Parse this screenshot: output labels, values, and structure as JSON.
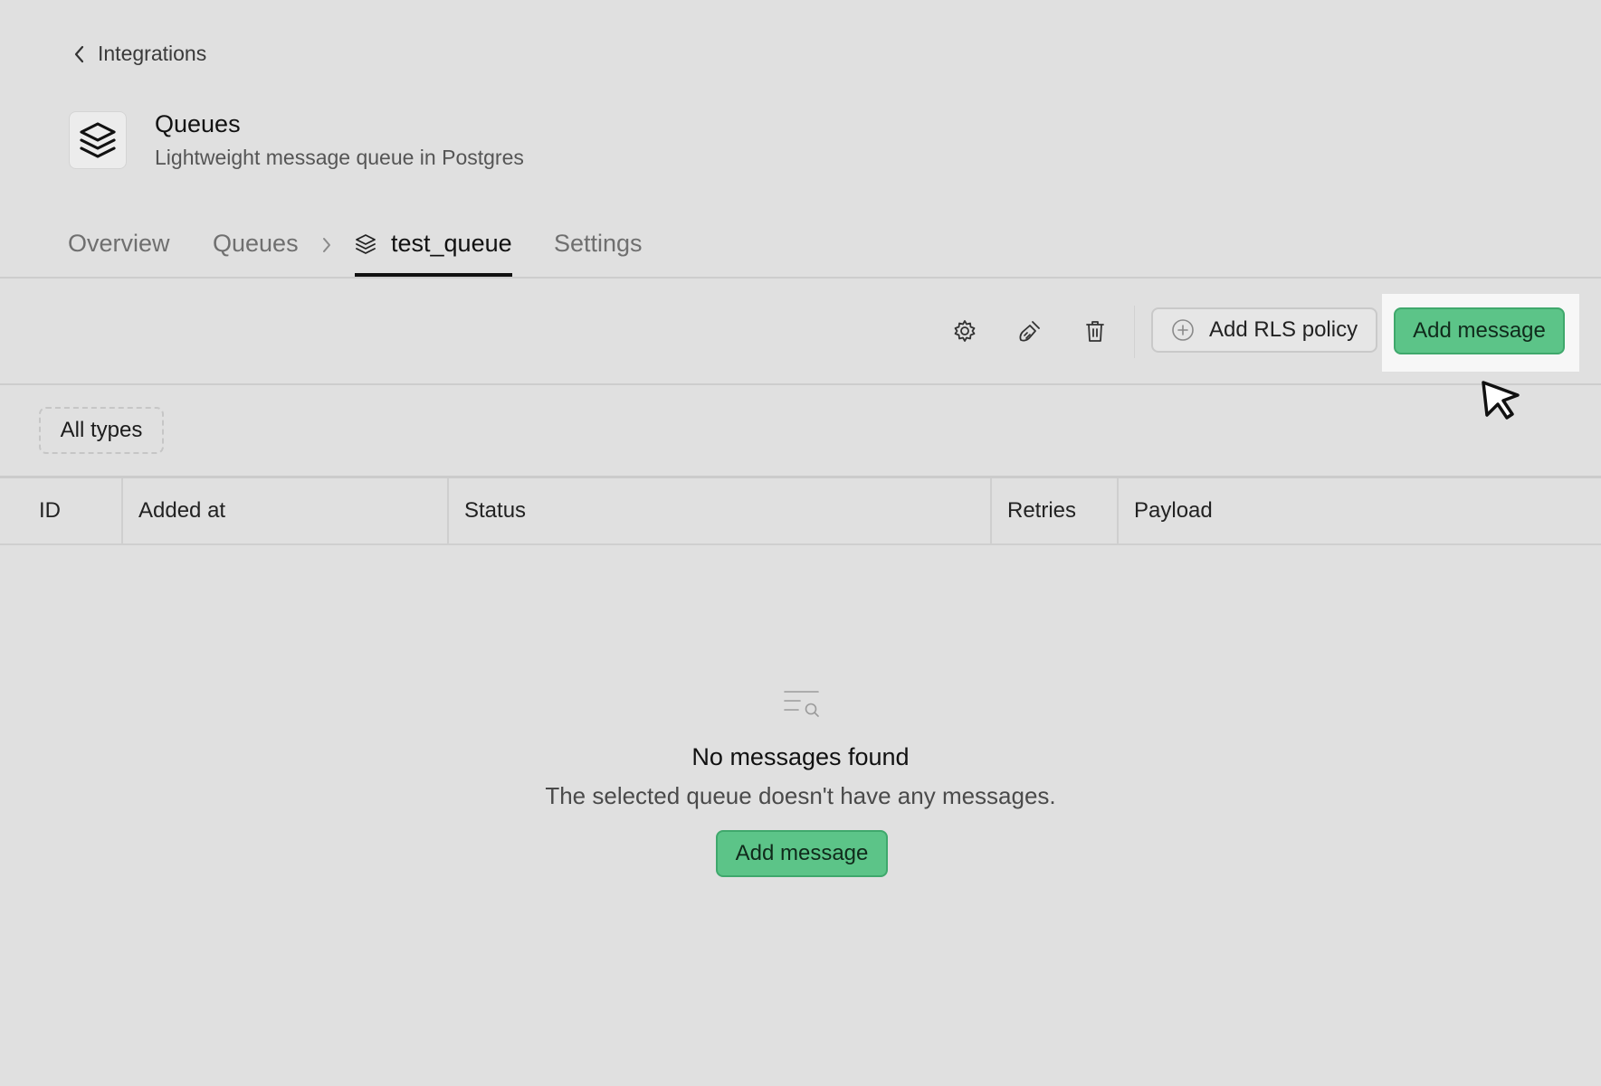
{
  "back_link": {
    "label": "Integrations"
  },
  "app": {
    "title": "Queues",
    "subtitle": "Lightweight message queue in Postgres",
    "icon": "layers-icon"
  },
  "tabs": [
    {
      "label": "Overview",
      "active": false
    },
    {
      "label": "Queues",
      "active": false
    },
    {
      "label": "test_queue",
      "active": true,
      "icon": "layers-icon"
    },
    {
      "label": "Settings",
      "active": false
    }
  ],
  "toolbar": {
    "icons": [
      "gear-icon",
      "broom-icon",
      "trash-icon"
    ],
    "rls_button": "Add RLS policy",
    "add_message_button": "Add message"
  },
  "filter": {
    "label": "All types"
  },
  "table": {
    "columns": [
      "ID",
      "Added at",
      "Status",
      "Retries",
      "Payload"
    ],
    "rows": []
  },
  "empty_state": {
    "title": "No messages found",
    "description": "The selected queue doesn't have any messages.",
    "button": "Add message"
  },
  "colors": {
    "background": "#e0e0e0",
    "accent": "#5cc488",
    "accent_border": "#3fa86c"
  }
}
